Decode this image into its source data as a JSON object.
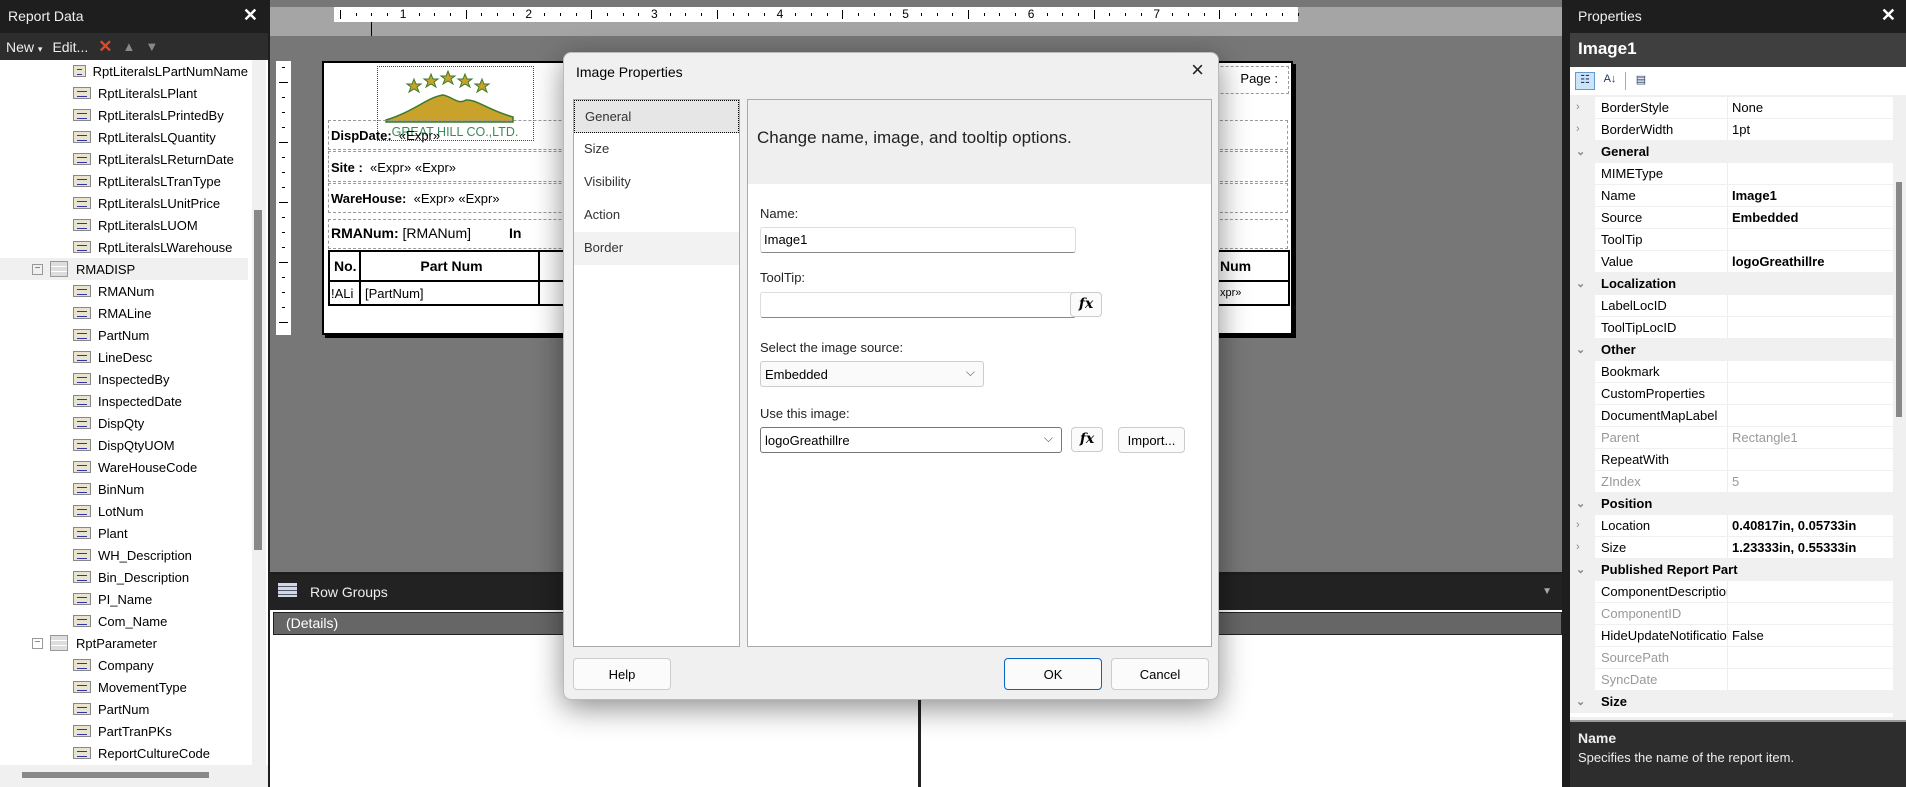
{
  "report_data": {
    "title": "Report Data",
    "toolbar": {
      "new": "New",
      "edit": "Edit..."
    },
    "tree": [
      {
        "type": "field",
        "label": "RptLiteralsLPartNumName"
      },
      {
        "type": "field",
        "label": "RptLiteralsLPlant"
      },
      {
        "type": "field",
        "label": "RptLiteralsLPrintedBy"
      },
      {
        "type": "field",
        "label": "RptLiteralsLQuantity"
      },
      {
        "type": "field",
        "label": "RptLiteralsLReturnDate"
      },
      {
        "type": "field",
        "label": "RptLiteralsLTranType"
      },
      {
        "type": "field",
        "label": "RptLiteralsLUnitPrice"
      },
      {
        "type": "field",
        "label": "RptLiteralsLUOM"
      },
      {
        "type": "field",
        "label": "RptLiteralsLWarehouse"
      },
      {
        "type": "dataset",
        "label": "RMADISP",
        "selected": true
      },
      {
        "type": "field",
        "label": "RMANum"
      },
      {
        "type": "field",
        "label": "RMALine"
      },
      {
        "type": "field",
        "label": "PartNum"
      },
      {
        "type": "field",
        "label": "LineDesc"
      },
      {
        "type": "field",
        "label": "InspectedBy"
      },
      {
        "type": "field",
        "label": "InspectedDate"
      },
      {
        "type": "field",
        "label": "DispQty"
      },
      {
        "type": "field",
        "label": "DispQtyUOM"
      },
      {
        "type": "field",
        "label": "WareHouseCode"
      },
      {
        "type": "field",
        "label": "BinNum"
      },
      {
        "type": "field",
        "label": "LotNum"
      },
      {
        "type": "field",
        "label": "Plant"
      },
      {
        "type": "field",
        "label": "WH_Description"
      },
      {
        "type": "field",
        "label": "Bin_Description"
      },
      {
        "type": "field",
        "label": "PI_Name"
      },
      {
        "type": "field",
        "label": "Com_Name"
      },
      {
        "type": "dataset",
        "label": "RptParameter"
      },
      {
        "type": "field",
        "label": "Company"
      },
      {
        "type": "field",
        "label": "MovementType"
      },
      {
        "type": "field",
        "label": "PartNum"
      },
      {
        "type": "field",
        "label": "PartTranPKs"
      },
      {
        "type": "field",
        "label": "ReportCultureCode"
      }
    ]
  },
  "ruler": {
    "labels": [
      "1",
      "2",
      "3",
      "4",
      "5",
      "6",
      "7"
    ]
  },
  "report": {
    "logo_text": "GREAT HILL CO.,LTD.",
    "page_label": "Page :",
    "disp_date_label": "DispDate:",
    "disp_date_value": "«Expr»",
    "site_label": "Site :",
    "site_value": "«Expr» «Expr»",
    "warehouse_label": "WareHouse:",
    "warehouse_value": "«Expr»  «Expr»",
    "rmanum_label": "RMANum:",
    "rmanum_value": "[RMANum]",
    "col3_partial": "In",
    "header_no": "No.",
    "header_partnum": "Part Num",
    "header_right": "Num",
    "row_no": "!ALi",
    "row_partnum": "[PartNum]",
    "row_col3": "[L",
    "row_right": "xpr»"
  },
  "groups": {
    "row_groups": "Row Groups",
    "details": "(Details)"
  },
  "dialog": {
    "title": "Image Properties",
    "nav": [
      "General",
      "Size",
      "Visibility",
      "Action",
      "Border"
    ],
    "selected_nav": "General",
    "header": "Change name, image, and tooltip options.",
    "name_label": "Name:",
    "name_value": "Image1",
    "tooltip_label": "ToolTip:",
    "tooltip_value": "",
    "source_label": "Select the image source:",
    "source_value": "Embedded",
    "image_label": "Use this image:",
    "image_value": "logoGreathillre",
    "fx": "fx",
    "import": "Import...",
    "help": "Help",
    "ok": "OK",
    "cancel": "Cancel"
  },
  "properties": {
    "title": "Properties",
    "object": "Image1",
    "rows": [
      {
        "kind": "prop",
        "exp": true,
        "name": "BorderStyle",
        "value": "None"
      },
      {
        "kind": "prop",
        "exp": true,
        "name": "BorderWidth",
        "value": "1pt"
      },
      {
        "kind": "cat",
        "name": "General"
      },
      {
        "kind": "prop",
        "name": "MIMEType",
        "value": ""
      },
      {
        "kind": "prop",
        "name": "Name",
        "value": "Image1",
        "bold": true
      },
      {
        "kind": "prop",
        "name": "Source",
        "value": "Embedded",
        "bold": true
      },
      {
        "kind": "prop",
        "name": "ToolTip",
        "value": ""
      },
      {
        "kind": "prop",
        "name": "Value",
        "value": "logoGreathillre",
        "bold": true
      },
      {
        "kind": "cat",
        "name": "Localization"
      },
      {
        "kind": "prop",
        "name": "LabelLocID",
        "value": ""
      },
      {
        "kind": "prop",
        "name": "ToolTipLocID",
        "value": ""
      },
      {
        "kind": "cat",
        "name": "Other"
      },
      {
        "kind": "prop",
        "name": "Bookmark",
        "value": ""
      },
      {
        "kind": "prop",
        "name": "CustomProperties",
        "value": ""
      },
      {
        "kind": "prop",
        "name": "DocumentMapLabel",
        "value": ""
      },
      {
        "kind": "prop",
        "name": "Parent",
        "value": "Rectangle1",
        "disabled": true
      },
      {
        "kind": "prop",
        "name": "RepeatWith",
        "value": ""
      },
      {
        "kind": "prop",
        "name": "ZIndex",
        "value": "5",
        "disabled": true
      },
      {
        "kind": "cat",
        "name": "Position"
      },
      {
        "kind": "prop",
        "exp": true,
        "name": "Location",
        "value": "0.40817in, 0.05733in",
        "bold": true
      },
      {
        "kind": "prop",
        "exp": true,
        "name": "Size",
        "value": "1.23333in, 0.55333in",
        "bold": true
      },
      {
        "kind": "cat",
        "name": "Published Report Part"
      },
      {
        "kind": "prop",
        "name": "ComponentDescription",
        "value": ""
      },
      {
        "kind": "prop",
        "name": "ComponentID",
        "value": "",
        "disabled": true
      },
      {
        "kind": "prop",
        "name": "HideUpdateNotifications",
        "value": "False"
      },
      {
        "kind": "prop",
        "name": "SourcePath",
        "value": "",
        "disabled": true
      },
      {
        "kind": "prop",
        "name": "SyncDate",
        "value": "",
        "disabled": true
      },
      {
        "kind": "cat",
        "name": "Size"
      }
    ],
    "desc_title": "Name",
    "desc_text": "Specifies the name of the report item."
  }
}
